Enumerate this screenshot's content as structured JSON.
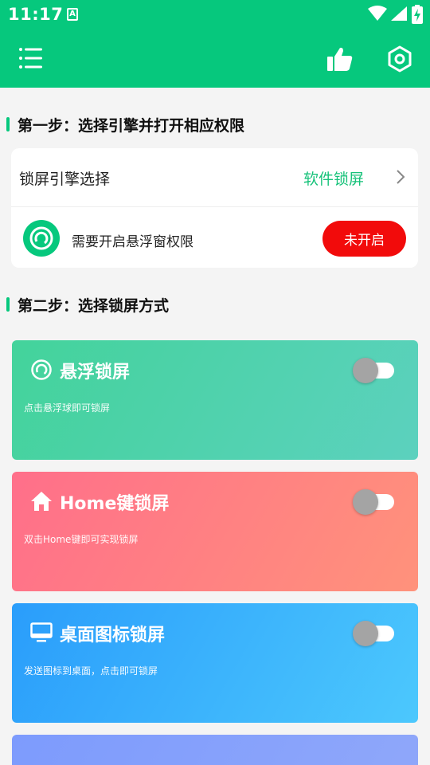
{
  "status_bar": {
    "time": "11:17",
    "notif_letter": "A"
  },
  "header": {
    "menu_icon": "menu-icon",
    "like_icon": "thumbs-up-icon",
    "settings_icon": "hexagon-settings-icon",
    "bg_color": "#06c87d"
  },
  "step1": {
    "title": "第一步：选择引擎并打开相应权限",
    "engine_label": "锁屏引擎选择",
    "engine_value": "软件锁屏",
    "permission_text": "需要开启悬浮窗权限",
    "permission_button": "未开启"
  },
  "step2": {
    "title": "第二步：选择锁屏方式"
  },
  "cards": [
    {
      "title": "悬浮锁屏",
      "desc": "点击悬浮球即可锁屏",
      "icon": "float-ball-icon",
      "enabled": false
    },
    {
      "title": "Home键锁屏",
      "desc": "双击Home键即可实现锁屏",
      "icon": "home-icon",
      "enabled": false
    },
    {
      "title": "桌面图标锁屏",
      "desc": "发送图标到桌面，点击即可锁屏",
      "icon": "monitor-icon",
      "enabled": false
    }
  ],
  "colors": {
    "accent": "#06c87d",
    "danger": "#f20b0b"
  }
}
